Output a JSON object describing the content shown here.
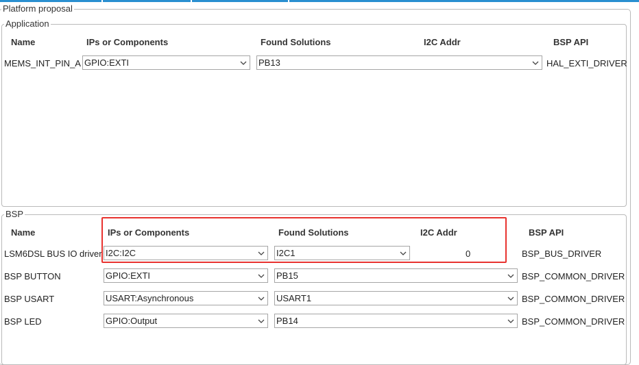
{
  "platform_proposal": {
    "title": "Platform proposal"
  },
  "application": {
    "title": "Application",
    "headers": {
      "name": "Name",
      "ips": "IPs or Components",
      "found": "Found Solutions",
      "i2c": "I2C Addr",
      "bsp_api": "BSP API"
    },
    "rows": [
      {
        "name": "MEMS_INT_PIN_A",
        "ip": "GPIO:EXTI",
        "found": "PB13",
        "api": "HAL_EXTI_DRIVER"
      }
    ]
  },
  "bsp": {
    "title": "BSP",
    "headers": {
      "name": "Name",
      "ips": "IPs or Components",
      "found": "Found Solutions",
      "i2c": "I2C Addr",
      "bsp_api": "BSP API"
    },
    "rows": [
      {
        "name": "LSM6DSL BUS IO driver",
        "ip": "I2C:I2C",
        "found": "I2C1",
        "i2c": "0",
        "api": "BSP_BUS_DRIVER"
      },
      {
        "name": "BSP BUTTON",
        "ip": "GPIO:EXTI",
        "found": "PB15",
        "api": "BSP_COMMON_DRIVER"
      },
      {
        "name": "BSP USART",
        "ip": "USART:Asynchronous",
        "found": "USART1",
        "api": "BSP_COMMON_DRIVER"
      },
      {
        "name": "BSP LED",
        "ip": "GPIO:Output",
        "found": "PB14",
        "api": "BSP_COMMON_DRIVER"
      }
    ]
  },
  "icons": {
    "dropdown": "chevron-down-icon"
  },
  "colors": {
    "highlight": "#e8322e",
    "accent_bar": "#2a8fd0"
  }
}
